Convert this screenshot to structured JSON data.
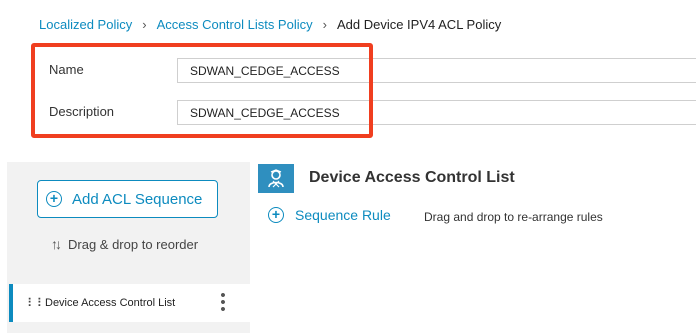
{
  "breadcrumb": {
    "items": [
      {
        "label": "Localized Policy"
      },
      {
        "label": "Access Control Lists Policy"
      }
    ],
    "current": "Add Device IPV4 ACL Policy"
  },
  "form": {
    "name_label": "Name",
    "name_value": "SDWAN_CEDGE_ACCESS",
    "description_label": "Description",
    "description_value": "SDWAN_CEDGE_ACCESS"
  },
  "colors": {
    "accent": "#0d8bbf",
    "highlight": "#f03e1f",
    "panel_bg": "#f2f2f2"
  },
  "sequence_panel": {
    "add_button_label": "Add ACL Sequence",
    "add_icon": "plus-circle-icon",
    "reorder_hint": "Drag & drop to reorder",
    "reorder_icon": "sort-arrows-icon",
    "items": [
      {
        "label": "Device Access Control List"
      }
    ]
  },
  "main": {
    "section_icon": "device-access-icon",
    "title": "Device Access Control List",
    "sequence_rule_label": "Sequence Rule",
    "drag_hint": "Drag and drop to re-arrange rules"
  }
}
